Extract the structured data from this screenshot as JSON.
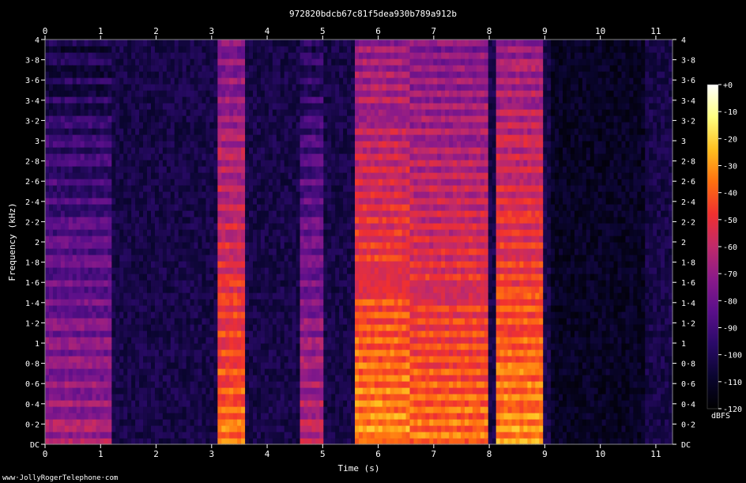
{
  "chart_data": {
    "type": "heatmap",
    "title": "972820bdcb67c81f5dea930b789a912b",
    "xlabel": "Time (s)",
    "ylabel": "Frequency (kHz)",
    "xlim": [
      0,
      11.3
    ],
    "ylim": [
      0,
      4.0
    ],
    "x_ticks": [
      "0",
      "1",
      "2",
      "3",
      "4",
      "5",
      "6",
      "7",
      "8",
      "9",
      "10",
      "11"
    ],
    "y_ticks": [
      "DC",
      "0·2",
      "0·4",
      "0·6",
      "0·8",
      "1",
      "1·2",
      "1·4",
      "1·6",
      "1·8",
      "2",
      "2·2",
      "2·4",
      "2·6",
      "2·8",
      "3",
      "3·2",
      "3·4",
      "3·6",
      "3·8",
      "4"
    ],
    "colorbar": {
      "label": "dBFS",
      "range": [
        -120,
        0
      ],
      "ticks": [
        "+0",
        "-10",
        "-20",
        "-30",
        "-40",
        "-50",
        "-60",
        "-70",
        "-80",
        "-90",
        "-100",
        "-110",
        "-120"
      ],
      "colormap": [
        "#000000",
        "#0a0530",
        "#2a0a68",
        "#5a0f8a",
        "#8a1a8a",
        "#c02a6a",
        "#f03030",
        "#ff7010",
        "#ffc020",
        "#ffff80",
        "#ffffff"
      ]
    },
    "segments": [
      {
        "start": 0.0,
        "end": 1.2,
        "f0": 0.2,
        "level": -60
      },
      {
        "start": 3.1,
        "end": 3.6,
        "f0": 0.18,
        "level": -30
      },
      {
        "start": 4.6,
        "end": 5.0,
        "f0": 0.2,
        "level": -55
      },
      {
        "start": 5.6,
        "end": 6.6,
        "f0": 0.13,
        "level": -25
      },
      {
        "start": 6.6,
        "end": 8.0,
        "f0": 0.12,
        "level": -30
      },
      {
        "start": 8.1,
        "end": 9.0,
        "f0": 0.15,
        "level": -25
      }
    ],
    "background_level": -105,
    "grid": false
  },
  "watermark": "www·JollyRogerTelephone·com"
}
